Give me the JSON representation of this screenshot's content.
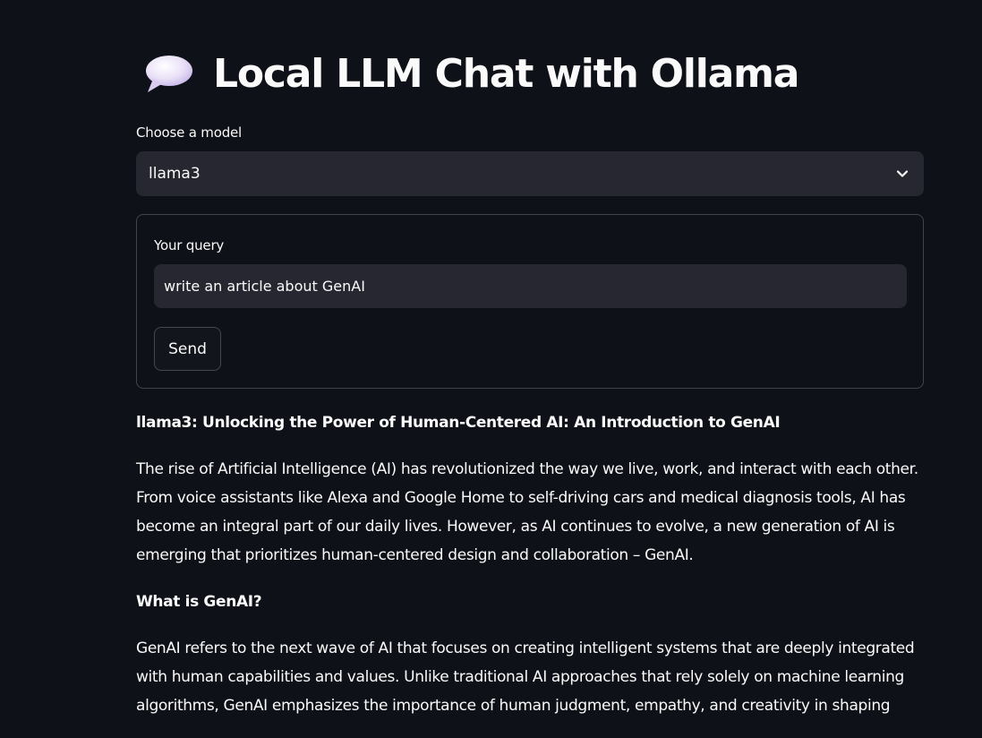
{
  "header": {
    "title": "Local LLM Chat with Ollama",
    "emoji_icon": "speech-balloon-icon"
  },
  "model_select": {
    "label": "Choose a model",
    "selected": "llama3"
  },
  "query_form": {
    "label": "Your query",
    "value": "write an article about GenAI",
    "send_label": "Send"
  },
  "response": {
    "title_line": "llama3: Unlocking the Power of Human-Centered AI: An Introduction to GenAI",
    "paragraph1": "The rise of Artificial Intelligence (AI) has revolutionized the way we live, work, and interact with each other. From voice assistants like Alexa and Google Home to self-driving cars and medical diagnosis tools, AI has become an integral part of our daily lives. However, as AI continues to evolve, a new generation of AI is emerging that prioritizes human-centered design and collaboration – GenAI.",
    "subheading": "What is GenAI?",
    "paragraph2": "GenAI refers to the next wave of AI that focuses on creating intelligent systems that are deeply integrated with human capabilities and values. Unlike traditional AI approaches that rely solely on machine learning algorithms, GenAI emphasizes the importance of human judgment, empathy, and creativity in shaping"
  },
  "colors": {
    "background": "#0e1117",
    "input_bg": "#262730",
    "text": "#fafafa"
  }
}
